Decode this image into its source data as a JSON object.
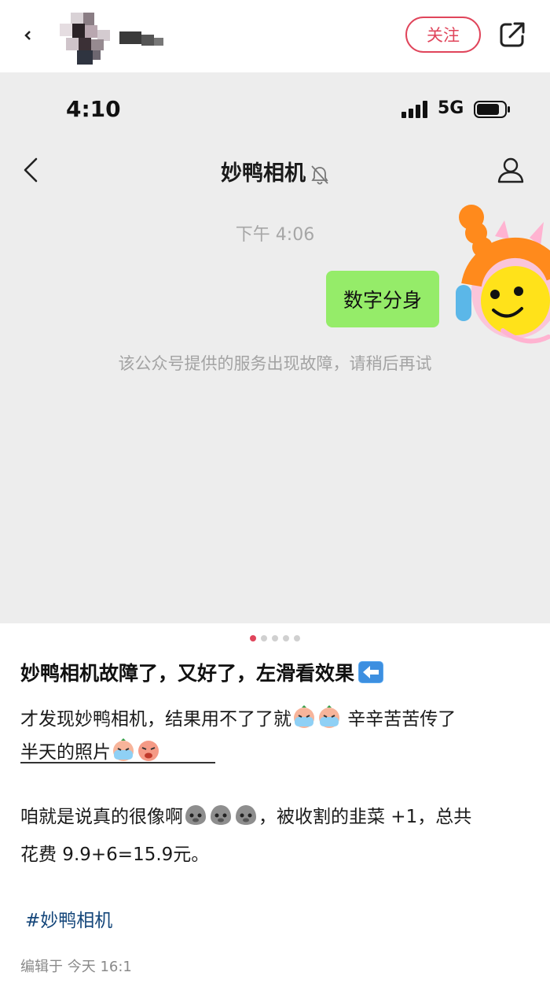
{
  "header": {
    "follow_label": "关注"
  },
  "screenshot": {
    "status_time": "4:10",
    "network": "5G",
    "chat_title": "妙鸭相机",
    "message_time": "下午 4:06",
    "sent_message": "数字分身",
    "system_notice": "该公众号提供的服务出现故障，请稍后再试",
    "bubble_color": "#95ec69"
  },
  "carousel": {
    "count": 5,
    "active_index": 0
  },
  "post": {
    "title": "妙鸭相机故障了，又好了，左滑看效果",
    "line1_text": "才发现妙鸭相机，结果用不了了就",
    "line1_tail": " 辛辛苦苦传了",
    "line2_text": "半天的照片",
    "line3_text": "咱就是说真的很像啊",
    "line3_tail": "，被收割的韭菜 +1，总共",
    "line4_text": "花费 9.9+6=15.9元。",
    "hashtag": "#妙鸭相机",
    "edited": "编辑于 今天 16:1"
  },
  "colors": {
    "accent": "#e0455b",
    "hashtag": "#14467a"
  }
}
